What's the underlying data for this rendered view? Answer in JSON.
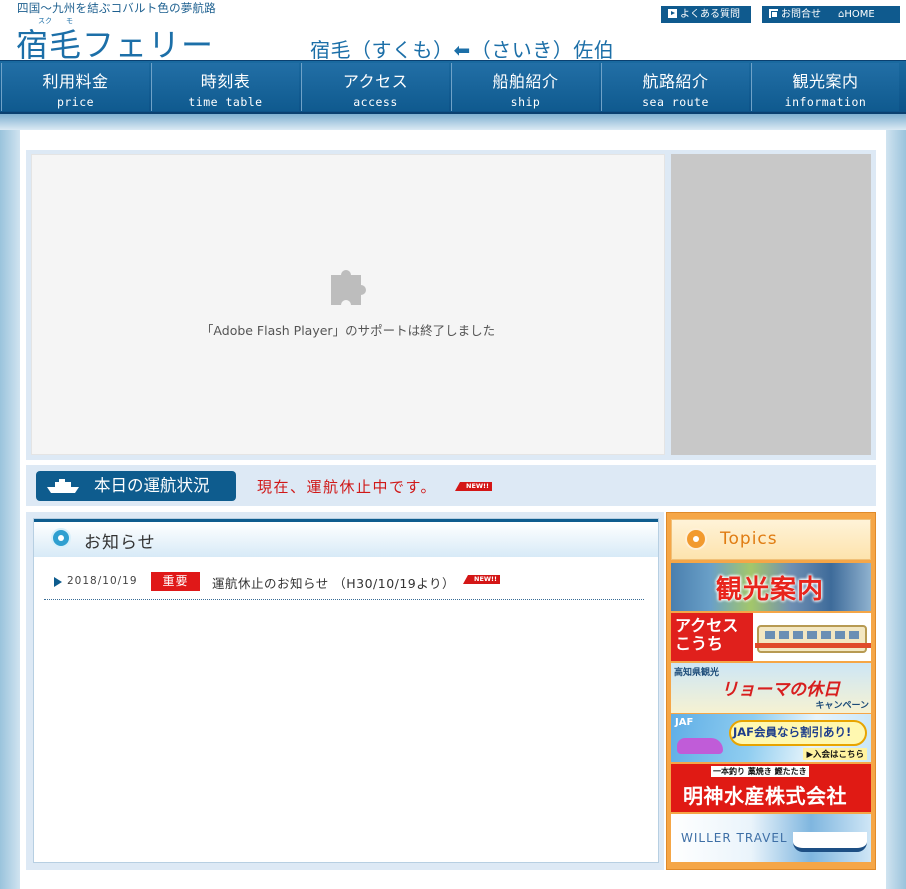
{
  "header": {
    "tagline": "四国～九州を結ぶコバルト色の夢航路",
    "logo_text": "宿毛フェリー",
    "logo_ruby_1": "スク",
    "logo_ruby_2": "モ",
    "route_text": "宿毛（すくも）⬅（さいき）佐伯",
    "faq_label": "よくある質問",
    "contact_label": "お問合せ",
    "home_label": "HOME"
  },
  "nav": {
    "items": [
      {
        "jp": "利用料金",
        "en": "price"
      },
      {
        "jp": "時刻表",
        "en": "time table"
      },
      {
        "jp": "アクセス",
        "en": "access"
      },
      {
        "jp": "船舶紹介",
        "en": "ship"
      },
      {
        "jp": "航路紹介",
        "en": "sea route"
      },
      {
        "jp": "観光案内",
        "en": "information"
      }
    ]
  },
  "flash": {
    "message": "「Adobe Flash Player」のサポートは終了しました"
  },
  "status": {
    "label": "本日の運航状況",
    "text": "現在、運航休止中です。",
    "new_badge": "NEW!!"
  },
  "news": {
    "title": "お知らせ",
    "items": [
      {
        "date": "2018/10/19",
        "tag": "重要",
        "text": "運航休止のお知らせ （H30/10/19より）",
        "new_badge": "NEW!!"
      }
    ]
  },
  "topics": {
    "title": "Topics",
    "banners": {
      "sightseeing": "観光案内",
      "access_l1": "アクセス",
      "access_l2": "こうち",
      "ryoma_top": "高知県観光",
      "ryoma_main": "リョーマの休日",
      "ryoma_bottom": "キャンペーン",
      "jaf_logo": "JAF",
      "jaf_main": "JAF会員なら割引あり!",
      "jaf_bottom": "▶入会はこちら",
      "myojin_top": "一本釣り 藁焼き 鰹たたき",
      "myojin_main": "明神水産株式会社",
      "willer": "WILLER TRAVEL"
    }
  },
  "colors": {
    "brand": "#0e5c8e",
    "alert": "#d01818",
    "topics_accent": "#f5a647"
  }
}
